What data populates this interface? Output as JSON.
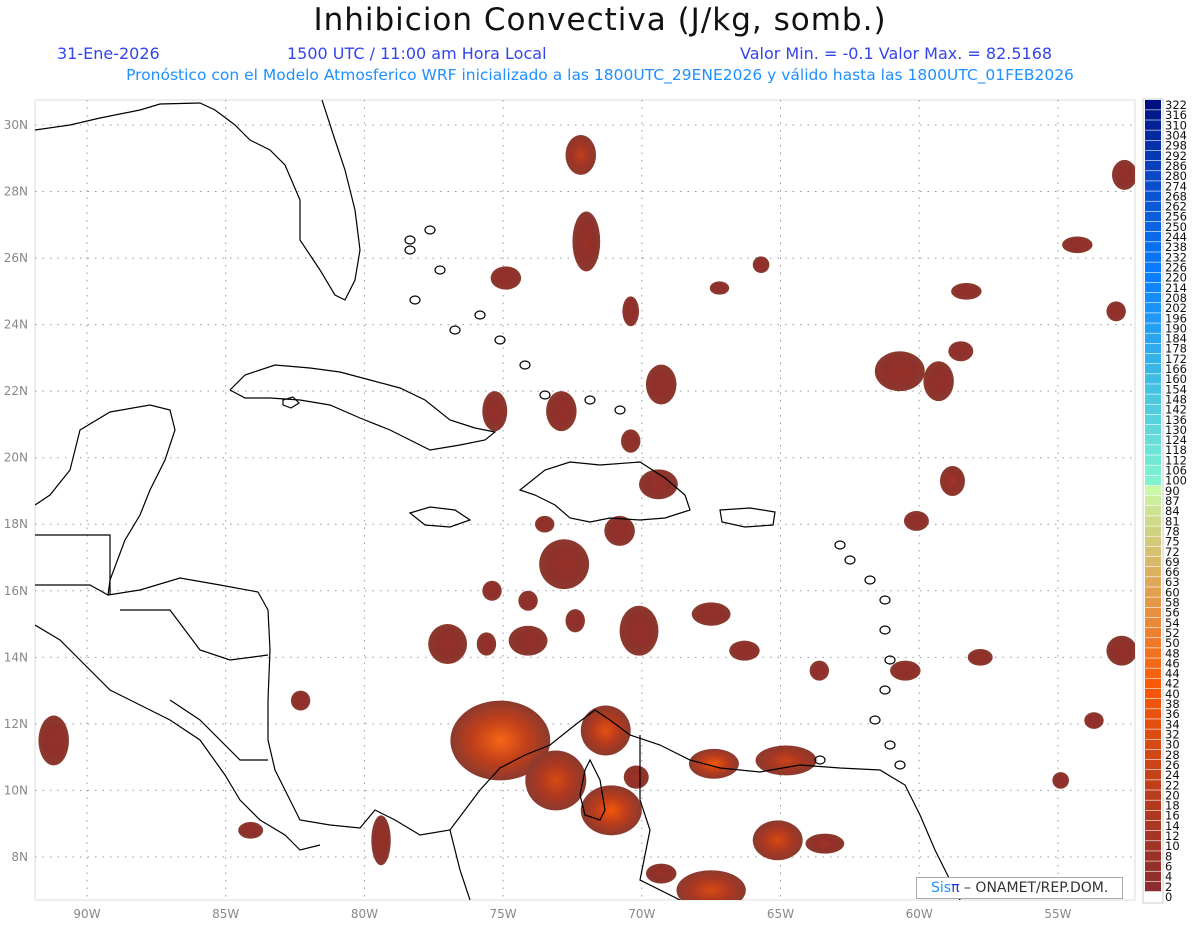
{
  "header": {
    "title": "Inhibicion Convectiva (J/kg, somb.)",
    "date": "31-Ene-2026",
    "time": "1500 UTC / 11:00 am Hora Local",
    "minmax": "Valor Min. = -0.1  Valor Max. = 82.5168",
    "model_line": "Pronóstico con el Modelo Atmosferico WRF inicializado a las 1800UTC_29ENE2026 y válido hasta las  1800UTC_01FEB2026"
  },
  "credit": {
    "brand": "Sis",
    "brand_symbol": "π",
    "text": "– ONAMET/REP.DOM."
  },
  "map": {
    "lon_range": [
      -91.9,
      -52.2
    ],
    "lat_range": [
      6.8,
      30.75
    ],
    "grid": true,
    "lon_ticks": [
      {
        "value": -90,
        "label": "90W"
      },
      {
        "value": -85,
        "label": "85W"
      },
      {
        "value": -80,
        "label": "80W"
      },
      {
        "value": -75,
        "label": "75W"
      },
      {
        "value": -70,
        "label": "70W"
      },
      {
        "value": -65,
        "label": "65W"
      },
      {
        "value": -60,
        "label": "60W"
      },
      {
        "value": -55,
        "label": "55W"
      }
    ],
    "lat_ticks": [
      {
        "value": 8,
        "label": "8N"
      },
      {
        "value": 10,
        "label": "10N"
      },
      {
        "value": 12,
        "label": "12N"
      },
      {
        "value": 14,
        "label": "14N"
      },
      {
        "value": 16,
        "label": "16N"
      },
      {
        "value": 18,
        "label": "18N"
      },
      {
        "value": 20,
        "label": "20N"
      },
      {
        "value": 22,
        "label": "22N"
      },
      {
        "value": 24,
        "label": "24N"
      },
      {
        "value": 26,
        "label": "26N"
      },
      {
        "value": 28,
        "label": "28N"
      },
      {
        "value": 30,
        "label": "30N"
      }
    ],
    "cin_areas": [
      {
        "lon": -72.2,
        "lat": 29.1,
        "rlon": 0.55,
        "rlat": 0.6,
        "value": 22
      },
      {
        "lon": -72.0,
        "lat": 26.5,
        "rlon": 0.5,
        "rlat": 0.9,
        "value": 8
      },
      {
        "lon": -74.9,
        "lat": 25.4,
        "rlon": 0.55,
        "rlat": 0.35,
        "value": 6
      },
      {
        "lon": -70.4,
        "lat": 24.4,
        "rlon": 0.3,
        "rlat": 0.45,
        "value": 5
      },
      {
        "lon": -69.3,
        "lat": 22.2,
        "rlon": 0.55,
        "rlat": 0.6,
        "value": 6
      },
      {
        "lon": -72.9,
        "lat": 21.4,
        "rlon": 0.55,
        "rlat": 0.6,
        "value": 6
      },
      {
        "lon": -75.3,
        "lat": 21.4,
        "rlon": 0.45,
        "rlat": 0.6,
        "value": 6
      },
      {
        "lon": -70.4,
        "lat": 20.5,
        "rlon": 0.35,
        "rlat": 0.35,
        "value": 5
      },
      {
        "lon": -69.4,
        "lat": 19.2,
        "rlon": 0.7,
        "rlat": 0.45,
        "value": 8
      },
      {
        "lon": -70.8,
        "lat": 17.8,
        "rlon": 0.55,
        "rlat": 0.45,
        "value": 6
      },
      {
        "lon": -72.8,
        "lat": 16.8,
        "rlon": 0.9,
        "rlat": 0.75,
        "value": 7
      },
      {
        "lon": -73.5,
        "lat": 18.0,
        "rlon": 0.35,
        "rlat": 0.25,
        "value": 5
      },
      {
        "lon": -70.1,
        "lat": 14.8,
        "rlon": 0.7,
        "rlat": 0.75,
        "value": 6
      },
      {
        "lon": -74.1,
        "lat": 14.5,
        "rlon": 0.7,
        "rlat": 0.45,
        "value": 6
      },
      {
        "lon": -77.0,
        "lat": 14.4,
        "rlon": 0.7,
        "rlat": 0.6,
        "value": 6
      },
      {
        "lon": -75.6,
        "lat": 14.4,
        "rlon": 0.35,
        "rlat": 0.35,
        "value": 5
      },
      {
        "lon": -72.4,
        "lat": 15.1,
        "rlon": 0.35,
        "rlat": 0.35,
        "value": 5
      },
      {
        "lon": -67.5,
        "lat": 15.3,
        "rlon": 0.7,
        "rlat": 0.35,
        "value": 6
      },
      {
        "lon": -66.3,
        "lat": 14.2,
        "rlon": 0.55,
        "rlat": 0.3,
        "value": 5
      },
      {
        "lon": -63.6,
        "lat": 13.6,
        "rlon": 0.35,
        "rlat": 0.3,
        "value": 5
      },
      {
        "lon": -60.5,
        "lat": 13.6,
        "rlon": 0.55,
        "rlat": 0.3,
        "value": 5
      },
      {
        "lon": -57.8,
        "lat": 14.0,
        "rlon": 0.45,
        "rlat": 0.25,
        "value": 5
      },
      {
        "lon": -52.7,
        "lat": 14.2,
        "rlon": 0.55,
        "rlat": 0.45,
        "value": 6
      },
      {
        "lon": -60.7,
        "lat": 22.6,
        "rlon": 0.9,
        "rlat": 0.6,
        "value": 7
      },
      {
        "lon": -59.3,
        "lat": 22.3,
        "rlon": 0.55,
        "rlat": 0.6,
        "value": 6
      },
      {
        "lon": -58.5,
        "lat": 23.2,
        "rlon": 0.45,
        "rlat": 0.3,
        "value": 5
      },
      {
        "lon": -58.8,
        "lat": 19.3,
        "rlon": 0.45,
        "rlat": 0.45,
        "value": 10
      },
      {
        "lon": -60.1,
        "lat": 18.1,
        "rlon": 0.45,
        "rlat": 0.3,
        "value": 5
      },
      {
        "lon": -52.9,
        "lat": 24.4,
        "rlon": 0.35,
        "rlat": 0.3,
        "value": 5
      },
      {
        "lon": -54.3,
        "lat": 26.4,
        "rlon": 0.55,
        "rlat": 0.25,
        "value": 5
      },
      {
        "lon": -52.6,
        "lat": 28.5,
        "rlon": 0.45,
        "rlat": 0.45,
        "value": 5
      },
      {
        "lon": -58.3,
        "lat": 25.0,
        "rlon": 0.55,
        "rlat": 0.25,
        "value": 5
      },
      {
        "lon": -65.7,
        "lat": 25.8,
        "rlon": 0.3,
        "rlat": 0.25,
        "value": 5
      },
      {
        "lon": -67.2,
        "lat": 25.1,
        "rlon": 0.35,
        "rlat": 0.2,
        "value": 5
      },
      {
        "lon": -75.1,
        "lat": 11.5,
        "rlon": 1.8,
        "rlat": 1.2,
        "value": 45
      },
      {
        "lon": -71.3,
        "lat": 11.8,
        "rlon": 0.9,
        "rlat": 0.75,
        "value": 35
      },
      {
        "lon": -73.1,
        "lat": 10.3,
        "rlon": 1.1,
        "rlat": 0.9,
        "value": 30
      },
      {
        "lon": -71.1,
        "lat": 9.4,
        "rlon": 1.1,
        "rlat": 0.75,
        "value": 40
      },
      {
        "lon": -67.4,
        "lat": 10.8,
        "rlon": 0.9,
        "rlat": 0.45,
        "value": 40
      },
      {
        "lon": -64.8,
        "lat": 10.9,
        "rlon": 1.1,
        "rlat": 0.45,
        "value": 25
      },
      {
        "lon": -65.1,
        "lat": 8.5,
        "rlon": 0.9,
        "rlat": 0.6,
        "value": 30
      },
      {
        "lon": -63.4,
        "lat": 8.4,
        "rlon": 0.7,
        "rlat": 0.3,
        "value": 10
      },
      {
        "lon": -67.5,
        "lat": 7.0,
        "rlon": 1.25,
        "rlat": 0.6,
        "value": 30
      },
      {
        "lon": -69.3,
        "lat": 7.5,
        "rlon": 0.55,
        "rlat": 0.3,
        "value": 8
      },
      {
        "lon": -91.2,
        "lat": 11.5,
        "rlon": 0.55,
        "rlat": 0.75,
        "value": 6
      },
      {
        "lon": -82.3,
        "lat": 12.7,
        "rlon": 0.35,
        "rlat": 0.3,
        "value": 5
      },
      {
        "lon": -79.4,
        "lat": 8.5,
        "rlon": 0.35,
        "rlat": 0.75,
        "value": 8
      },
      {
        "lon": -70.2,
        "lat": 10.4,
        "rlon": 0.45,
        "rlat": 0.35,
        "value": 10
      },
      {
        "lon": -53.7,
        "lat": 12.1,
        "rlon": 0.35,
        "rlat": 0.25,
        "value": 5
      },
      {
        "lon": -54.9,
        "lat": 10.3,
        "rlon": 0.3,
        "rlat": 0.25,
        "value": 5
      },
      {
        "lon": -84.1,
        "lat": 8.8,
        "rlon": 0.45,
        "rlat": 0.25,
        "value": 5
      },
      {
        "lon": -74.1,
        "lat": 15.7,
        "rlon": 0.35,
        "rlat": 0.3,
        "value": 5
      },
      {
        "lon": -75.4,
        "lat": 16.0,
        "rlon": 0.35,
        "rlat": 0.3,
        "value": 5
      }
    ]
  },
  "colorbar": {
    "levels": [
      0,
      2,
      4,
      6,
      8,
      10,
      12,
      14,
      16,
      18,
      20,
      22,
      24,
      26,
      28,
      30,
      32,
      34,
      36,
      38,
      40,
      42,
      44,
      46,
      48,
      50,
      52,
      54,
      56,
      58,
      60,
      63,
      66,
      69,
      72,
      75,
      78,
      81,
      84,
      87,
      90,
      100,
      106,
      112,
      118,
      124,
      130,
      136,
      142,
      148,
      154,
      160,
      166,
      172,
      178,
      184,
      190,
      196,
      202,
      208,
      214,
      220,
      226,
      232,
      238,
      244,
      250,
      256,
      262,
      268,
      274,
      280,
      286,
      292,
      298,
      304,
      310,
      316,
      322
    ],
    "color_stops": [
      {
        "v": 2,
        "c": "#8b2d2d"
      },
      {
        "v": 20,
        "c": "#b93c1c"
      },
      {
        "v": 42,
        "c": "#fa5a08"
      },
      {
        "v": 60,
        "c": "#e0a050"
      },
      {
        "v": 81,
        "c": "#cfd98a"
      },
      {
        "v": 90,
        "c": "#c8f8a8"
      },
      {
        "v": 100,
        "c": "#7ff3d0"
      },
      {
        "v": 160,
        "c": "#40bde3"
      },
      {
        "v": 220,
        "c": "#0a80ff"
      },
      {
        "v": 280,
        "c": "#0a48c8"
      },
      {
        "v": 322,
        "c": "#001080"
      }
    ],
    "zero_color": "#ffffff"
  },
  "colors": {
    "land_line": "#000000",
    "cin_base": "#8b3a2e",
    "grid": "#999999",
    "tick_label": "#888888"
  }
}
